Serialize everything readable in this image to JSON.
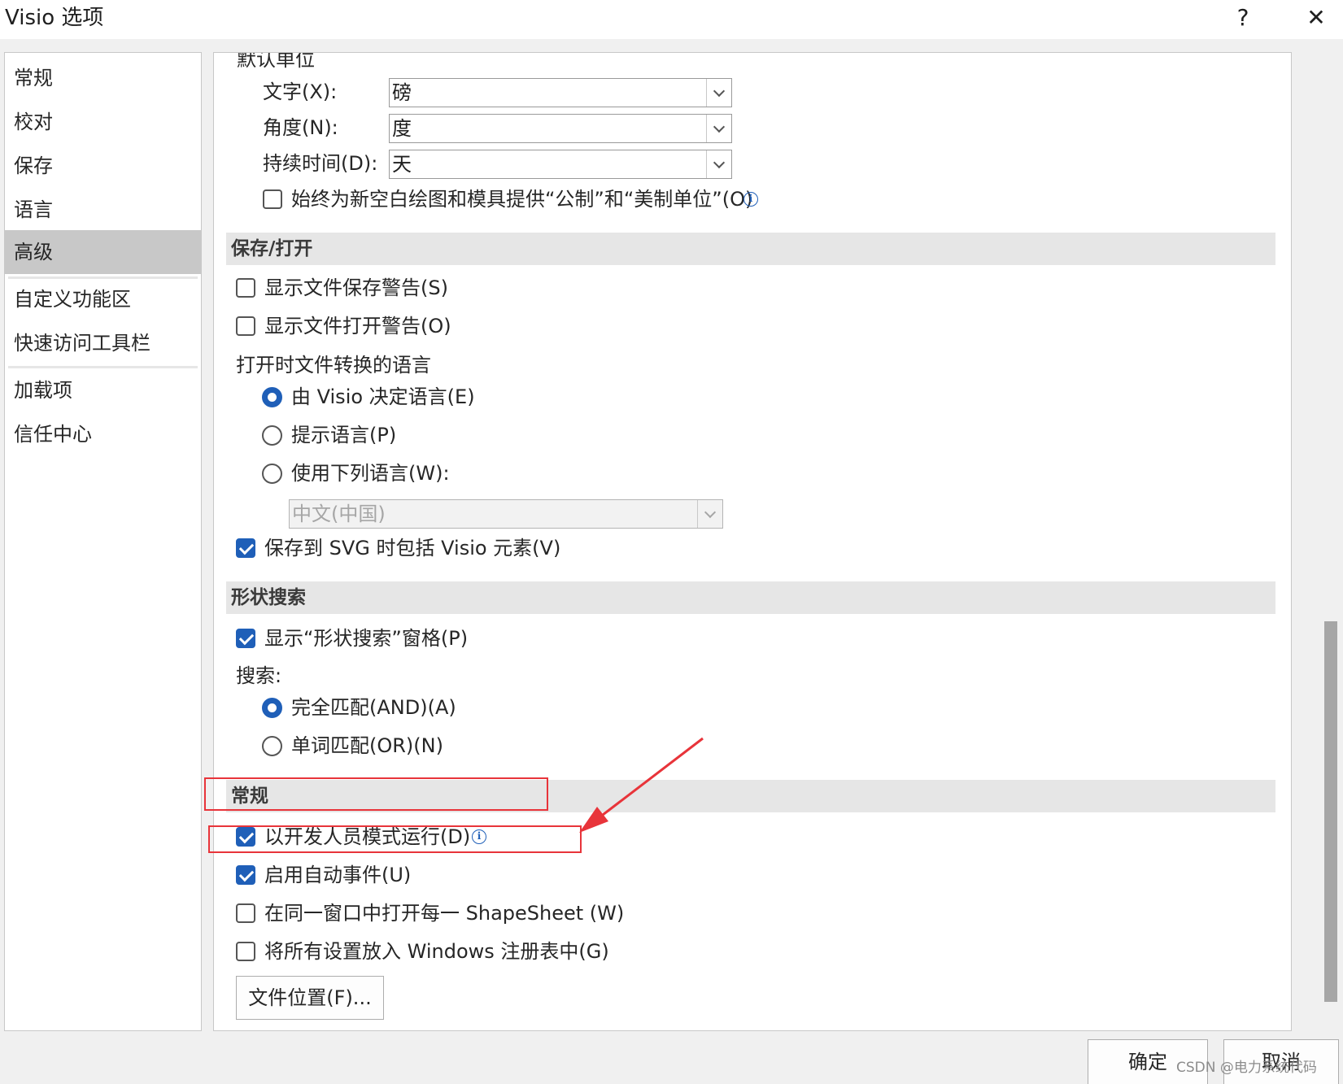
{
  "window": {
    "title": "Visio 选项",
    "help_label": "?",
    "close_label": "✕"
  },
  "sidebar": {
    "items": [
      {
        "label": "常规"
      },
      {
        "label": "校对"
      },
      {
        "label": "保存"
      },
      {
        "label": "语言"
      },
      {
        "label": "高级"
      },
      {
        "label": "自定义功能区"
      },
      {
        "label": "快速访问工具栏"
      },
      {
        "label": "加载项"
      },
      {
        "label": "信任中心"
      }
    ],
    "active": "高级"
  },
  "units": {
    "heading": "默认单位",
    "text_label": "文字(X):",
    "text_value": "磅",
    "angle_label": "角度(N):",
    "angle_value": "度",
    "duration_label": "持续时间(D):",
    "duration_value": "天",
    "metric_us_label": "始终为新空白绘图和模具提供“公制”和“美制单位”(O)",
    "metric_us_checked": false
  },
  "save_open": {
    "heading": "保存/打开",
    "show_save_warning": {
      "label": "显示文件保存警告(S)",
      "checked": false
    },
    "show_open_warning": {
      "label": "显示文件打开警告(O)",
      "checked": false
    },
    "convert_lang_label": "打开时文件转换的语言",
    "radio_visio": {
      "label": "由 Visio 决定语言(E)",
      "checked": true
    },
    "radio_prompt": {
      "label": "提示语言(P)",
      "checked": false
    },
    "radio_use": {
      "label": "使用下列语言(W):",
      "checked": false
    },
    "language_select_value": "中文(中国)",
    "svg_include": {
      "label": "保存到 SVG 时包括 Visio 元素(V)",
      "checked": true
    }
  },
  "shape_search": {
    "heading": "形状搜索",
    "show_pane": {
      "label": "显示“形状搜索”窗格(P)",
      "checked": true
    },
    "search_label": "搜索:",
    "radio_and": {
      "label": "完全匹配(AND)(A)",
      "checked": true
    },
    "radio_or": {
      "label": "单词匹配(OR)(N)",
      "checked": false
    }
  },
  "general": {
    "heading": "常规",
    "developer_mode": {
      "label": "以开发人员模式运行(D)",
      "checked": true
    },
    "auto_events": {
      "label": "启用自动事件(U)",
      "checked": true
    },
    "same_window": {
      "label": "在同一窗口中打开每一 ShapeSheet (W)",
      "checked": false
    },
    "registry": {
      "label": "将所有设置放入 Windows 注册表中(G)",
      "checked": false
    },
    "file_locations_label": "文件位置(F)..."
  },
  "footer": {
    "ok_label": "确定",
    "cancel_label": "取消"
  },
  "watermark": "CSDN @电力系统代码",
  "colors": {
    "accent": "#1f5fb8",
    "annotation": "#e8343a",
    "active_item": "#c8c8c8"
  }
}
